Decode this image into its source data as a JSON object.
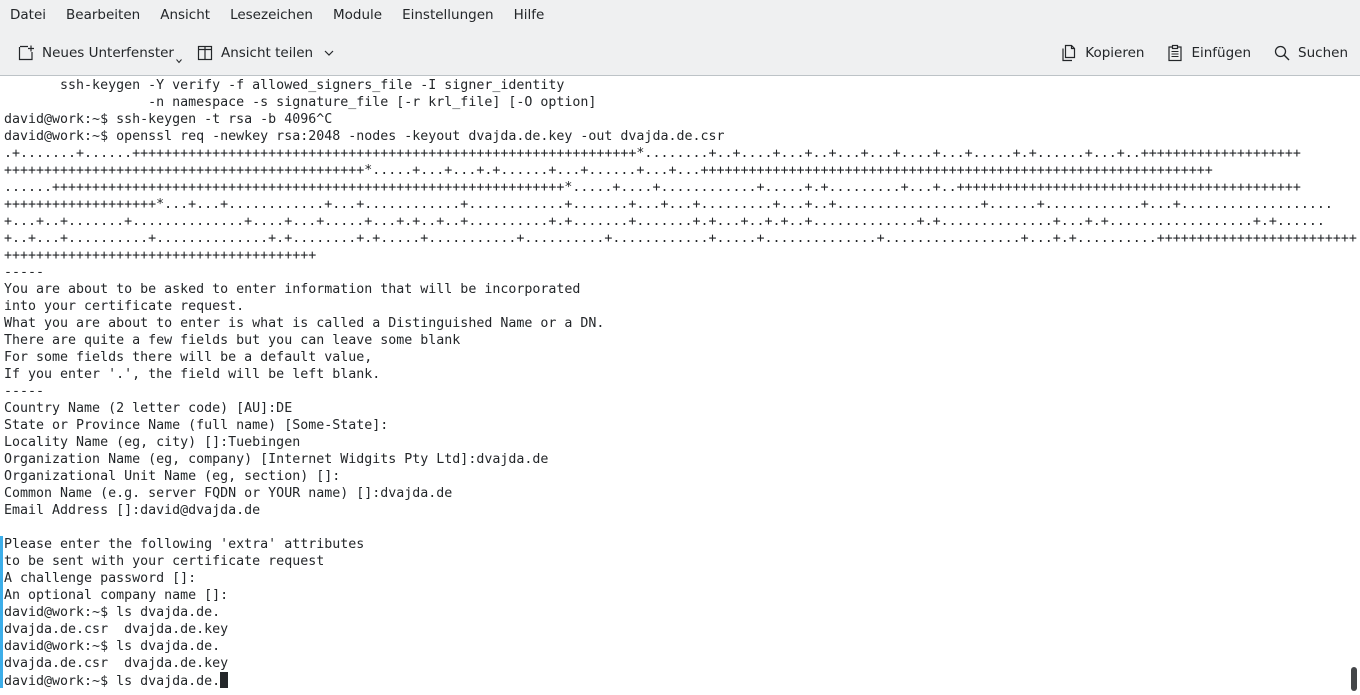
{
  "menu": {
    "items": [
      "Datei",
      "Bearbeiten",
      "Ansicht",
      "Lesezeichen",
      "Module",
      "Einstellungen",
      "Hilfe"
    ]
  },
  "toolbar": {
    "new_tab_label": "Neues Unterfenster",
    "split_view_label": "Ansicht teilen",
    "copy_label": "Kopieren",
    "paste_label": "Einfügen",
    "search_label": "Suchen"
  },
  "terminal": {
    "lines": [
      "       ssh-keygen -Y verify -f allowed_signers_file -I signer_identity",
      "                  -n namespace -s signature_file [-r krl_file] [-O option]",
      "david@work:~$ ssh-keygen -t rsa -b 4096^C",
      "david@work:~$ openssl req -newkey rsa:2048 -nodes -keyout dvajda.de.key -out dvajda.de.csr",
      ".+.......+......+++++++++++++++++++++++++++++++++++++++++++++++++++++++++++++++*........+..+....+...+..+...+...+....+...+.....+.+......+...+..++++++++++++++++++++",
      "+++++++++++++++++++++++++++++++++++++++++++++*.....+...+...+.+......+...+......+...+...++++++++++++++++++++++++++++++++++++++++++++++++++++++++++++++++",
      "......++++++++++++++++++++++++++++++++++++++++++++++++++++++++++++++++*.....+....+............+.....+.+.........+...+..+++++++++++++++++++++++++++++++++++++++++++",
      "+++++++++++++++++++*...+...+............+...+............+............+.......+...+...+.........+...+..+..................+......+............+...+...................",
      "+...+..+.......+..............+....+...+.....+...+.+..+..+..........+.+.......+.......+.+...+..+.+..+.............+.+..............+...+.+..................+.+......",
      "+..+...+..........+..............+.+........+.+.....+...........+..........+............+.....+..............+.................+...+.+..........+++++++++++++++++++++++++",
      "+++++++++++++++++++++++++++++++++++++++",
      "-----",
      "You are about to be asked to enter information that will be incorporated",
      "into your certificate request.",
      "What you are about to enter is what is called a Distinguished Name or a DN.",
      "There are quite a few fields but you can leave some blank",
      "For some fields there will be a default value,",
      "If you enter '.', the field will be left blank.",
      "-----",
      "Country Name (2 letter code) [AU]:DE",
      "State or Province Name (full name) [Some-State]:",
      "Locality Name (eg, city) []:Tuebingen",
      "Organization Name (eg, company) [Internet Widgits Pty Ltd]:dvajda.de",
      "Organizational Unit Name (eg, section) []:",
      "Common Name (e.g. server FQDN or YOUR name) []:dvajda.de",
      "Email Address []:david@dvajda.de",
      "",
      "Please enter the following 'extra' attributes",
      "to be sent with your certificate request",
      "A challenge password []:",
      "An optional company name []:",
      "david@work:~$ ls dvajda.de.",
      "dvajda.de.csr  dvajda.de.key",
      "david@work:~$ ls dvajda.de.",
      "dvajda.de.csr  dvajda.de.key",
      "david@work:~$ ls dvajda.de."
    ]
  },
  "colors": {
    "chrome_bg": "#eff0f1",
    "text": "#232629",
    "accent": "#3daee9"
  },
  "icons": {
    "new_tab": "new-tab-icon",
    "split_view": "split-view-icon",
    "copy": "copy-icon",
    "paste": "paste-icon",
    "search": "search-icon"
  }
}
